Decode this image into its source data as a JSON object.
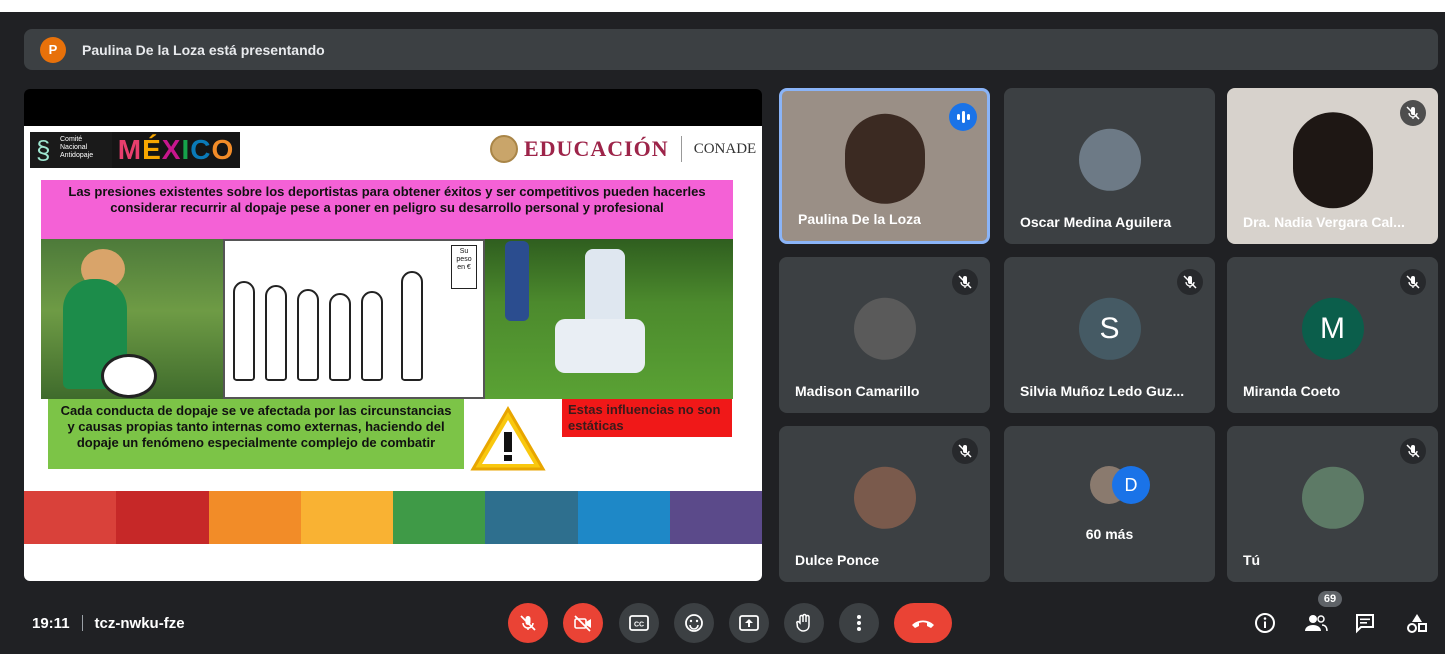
{
  "banner": {
    "avatar_letter": "P",
    "text": "Paulina De la Loza está presentando"
  },
  "slide": {
    "logo_cna": "Comité Nacional Antidopaje",
    "logo_mexico": [
      "M",
      "É",
      "X",
      "I",
      "C",
      "O"
    ],
    "logo_educacion": "EDUCACIÓN",
    "logo_conade": "CONADE",
    "pink_text": "Las presiones existentes sobre los deportistas para obtener éxitos y ser competitivos pueden hacerles considerar recurrir al dopaje pese a poner en peligro su desarrollo personal y profesional",
    "cartoon_bubble": "Su peso en €",
    "green_text": "Cada conducta de dopaje se ve afectada por las circunstancias y causas propias tanto internas como externas, haciendo del dopaje un fenómeno especialmente complejo de combatir",
    "red_text": "Estas influencias no son estáticas",
    "stripe_colors": [
      "#d9413a",
      "#c62828",
      "#f28c28",
      "#f9b233",
      "#3f9a47",
      "#2e6f8e",
      "#1e88c7",
      "#5b4a8a"
    ]
  },
  "participants": [
    {
      "name": "Paulina De la Loza",
      "speaking": true
    },
    {
      "name": "Oscar Medina Aguilera"
    },
    {
      "name": "Dra. Nadia Vergara Cal...",
      "muted": true
    },
    {
      "name": "Madison Camarillo",
      "muted": true
    },
    {
      "name": "Silvia Muñoz Ledo Guz...",
      "muted": true,
      "initial": "S",
      "color": "#455a64"
    },
    {
      "name": "Miranda Coeto",
      "muted": true,
      "initial": "M",
      "color": "#0b5e4b"
    },
    {
      "name": "Dulce Ponce",
      "muted": true
    },
    {
      "name": "60 más",
      "initial": "D",
      "color": "#1a73e8"
    },
    {
      "name": "Tú",
      "muted": true
    }
  ],
  "bottom": {
    "time": "19:11",
    "meeting_code": "tcz-nwku-fze",
    "people_count": "69"
  },
  "colors": {
    "bg": "#202124",
    "tile": "#3c4043",
    "red": "#ea4335",
    "accent": "#8ab4f8"
  }
}
